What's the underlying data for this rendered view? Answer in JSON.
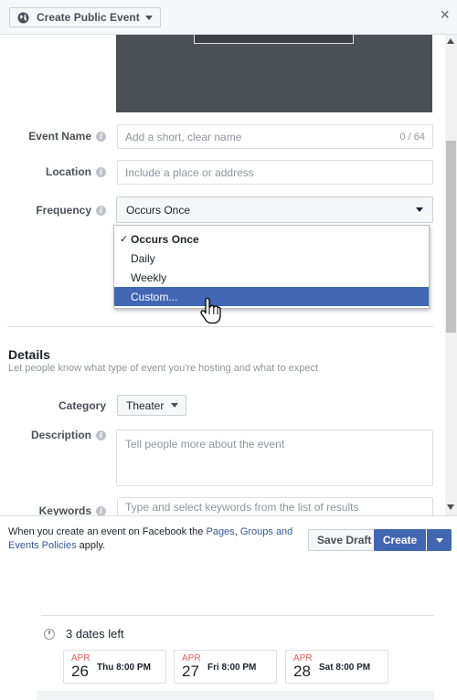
{
  "dialog": {
    "type_label": "Create Public Event",
    "close_label": "×"
  },
  "form": {
    "event_name": {
      "label": "Event Name",
      "placeholder": "Add a short, clear name",
      "counter": "0 / 64"
    },
    "location": {
      "label": "Location",
      "placeholder": "Include a place or address"
    },
    "frequency": {
      "label": "Frequency",
      "selected": "Occurs Once",
      "options": [
        {
          "label": "Occurs Once",
          "checked": true
        },
        {
          "label": "Daily"
        },
        {
          "label": "Weekly"
        },
        {
          "label": "Custom...",
          "hovered": true
        }
      ]
    }
  },
  "details": {
    "title": "Details",
    "subtitle": "Let people know what type of event you're hosting and what to expect",
    "category": {
      "label": "Category",
      "value": "Theater"
    },
    "description": {
      "label": "Description",
      "placeholder": "Tell people more about the event"
    },
    "keywords": {
      "label": "Keywords",
      "placeholder": "Type and select keywords from the list of results"
    }
  },
  "footer": {
    "text_prefix": "When you create an event on Facebook the ",
    "link_pages": "Pages",
    "sep": ", ",
    "link_groups_events": "Groups and Events Policies",
    "text_suffix": " apply.",
    "save_draft": "Save Draft",
    "create": "Create"
  },
  "dates": {
    "heading": "3 dates left",
    "items": [
      {
        "month": "APR",
        "day": "26",
        "time": "Thu 8:00 PM"
      },
      {
        "month": "APR",
        "day": "27",
        "time": "Fri 8:00 PM"
      },
      {
        "month": "APR",
        "day": "28",
        "time": "Sat 8:00 PM"
      }
    ]
  },
  "colors": {
    "primary_blue": "#4267b2",
    "link_blue": "#365899",
    "month_red": "#e05f5f"
  }
}
